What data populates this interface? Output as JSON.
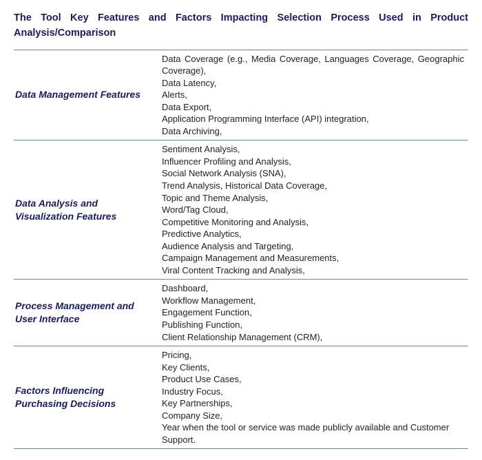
{
  "title": "The Tool Key Features and Factors Impacting Selection Process Used in Product Analysis/Comparison",
  "rows": [
    {
      "category": "Data Management Features",
      "items": [
        "Data Coverage (e.g., Media Coverage, Languages Coverage, Geographic Coverage),",
        "Data Latency,",
        "Alerts,",
        "Data Export,",
        "Application Programming Interface (API) integration,",
        "Data Archiving,"
      ]
    },
    {
      "category": "Data Analysis and Visualization Features",
      "items": [
        "Sentiment Analysis,",
        "Influencer Profiling and Analysis,",
        "Social Network Analysis (SNA),",
        "Trend Analysis, Historical Data Coverage,",
        "Topic and Theme Analysis,",
        "Word/Tag Cloud,",
        "Competitive Monitoring and Analysis,",
        "Predictive Analytics,",
        "Audience Analysis and Targeting,",
        "Campaign Management and Measurements,",
        "Viral Content Tracking and Analysis,"
      ]
    },
    {
      "category": "Process Management and User Interface",
      "items": [
        "Dashboard,",
        "Workflow Management,",
        "Engagement Function,",
        "Publishing Function,",
        "Client Relationship Management (CRM),"
      ]
    },
    {
      "category": "Factors Influencing Purchasing Decisions",
      "items": [
        "Pricing,",
        "Key Clients,",
        "Product Use Cases,",
        "Industry Focus,",
        "Key Partnerships,",
        "Company Size,",
        "Year when the tool or service was made publicly available and Customer Support."
      ]
    }
  ]
}
